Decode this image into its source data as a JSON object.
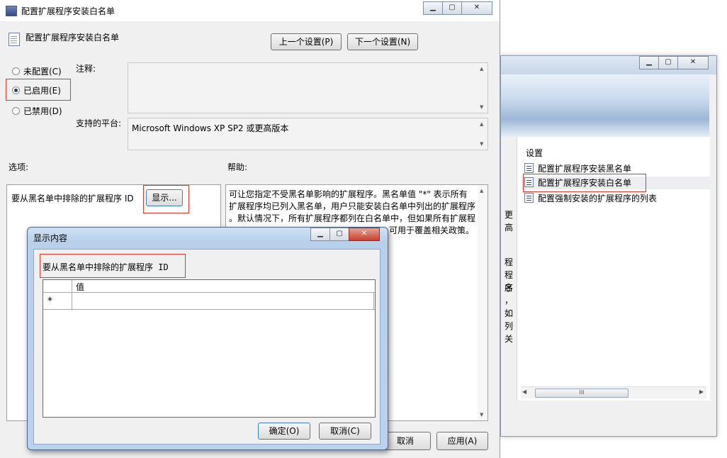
{
  "background_window": {
    "pane_header": "设置",
    "items": [
      {
        "label": "配置扩展程序安装黑名单"
      },
      {
        "label": "配置扩展程序安装白名单"
      },
      {
        "label": "配置强制安装的扩展程序的列表"
      }
    ],
    "clipped_text": [
      "更高",
      "程",
      "程序",
      "名",
      "，",
      "如",
      "列",
      "关"
    ],
    "hscroll_grip": "III",
    "window_buttons": {
      "minimize": "▁",
      "maximize": "▢",
      "close": "✕"
    }
  },
  "main_window": {
    "title": "配置扩展程序安装白名单",
    "heading": "配置扩展程序安装白名单",
    "prev_button": "上一个设置(P)",
    "next_button": "下一个设置(N)",
    "radio_not_configured": "未配置(C)",
    "radio_enabled": "已启用(E)",
    "radio_disabled": "已禁用(D)",
    "selected_option": "已启用(E)",
    "comment_label": "注释:",
    "platform_label": "支持的平台:",
    "platform_value": "Microsoft Windows XP SP2 或更高版本",
    "options_label": "选项:",
    "help_label": "帮助:",
    "option_text": "要从黑名单中排除的扩展程序 ID",
    "show_button": "显示...",
    "help_lines": [
      "可让您指定不受黑名单影响的扩展程序。黑名单值 \"*\" 表示所有",
      "扩展程序均已列入黑名单，用户只能安装白名单中列出的扩展程序",
      "。默认情况下，所有扩展程序都列在白名单中，但如果所有扩展程",
      "可用于覆盖相关政策。"
    ],
    "cancel_button": "取消",
    "apply_button": "应用(A)",
    "window_buttons": {
      "minimize": "▁",
      "maximize": "▢",
      "close": "✕"
    }
  },
  "dialog": {
    "title": "显示内容",
    "caption": "要从黑名单中排除的扩展程序 ID",
    "column_header": "值",
    "new_row_marker": "*",
    "ok_button": "确定(O)",
    "cancel_button": "取消(C)",
    "window_buttons": {
      "minimize": "▁",
      "maximize": "▢",
      "close": "✕"
    }
  },
  "colors": {
    "highlight_border": "#d93a2b",
    "dialog_frame": "#bcd2ec"
  }
}
